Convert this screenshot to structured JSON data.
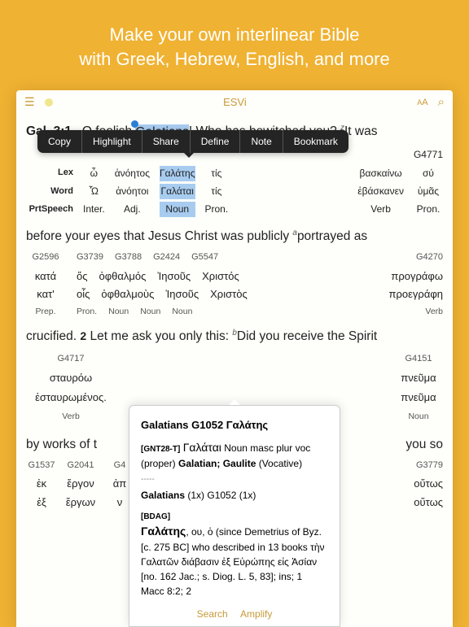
{
  "promo": {
    "line1": "Make your own interlinear Bible",
    "line2": "with Greek, Hebrew, English, and more"
  },
  "toolbar": {
    "title": "ESVi",
    "aa": "AA"
  },
  "popup": {
    "copy": "Copy",
    "highlight": "Highlight",
    "share": "Share",
    "define": "Define",
    "note": "Note",
    "bookmark": "Bookmark"
  },
  "verse1": {
    "ref": "Gal. 3:1",
    "pre": "O foolish ",
    "sel": "Galatians",
    "post1": "! Who has bewitched you? ",
    "sup_z": "z",
    "post2": "It was"
  },
  "int1": {
    "lex": "Lex",
    "word": "Word",
    "prt": "PrtSpeech",
    "s0": "",
    "s1": "",
    "s2": "",
    "s3": "",
    "s4": "",
    "s5": "",
    "s6": "G4771",
    "lx0": "ὦ",
    "lx1": "ἀνόητος",
    "lx2": "Γαλάτης",
    "lx3": "τίς",
    "lx5": "βασκαίνω",
    "lx6": "σύ",
    "wd0": "Ὦ",
    "wd1": "ἀνόητοι",
    "wd2": "Γαλάται",
    "wd3": "τίς",
    "wd5": "ἐβάσκανεν",
    "wd6": "ὑμᾶς",
    "ps0": "Inter.",
    "ps1": "Adj.",
    "ps2": "Noun",
    "ps3": "Pron.",
    "ps5": "Verb",
    "ps6": "Pron."
  },
  "verse2": {
    "text1": "before your eyes that Jesus Christ was publicly ",
    "sup_a": "a",
    "text2": "portrayed as"
  },
  "int2": {
    "s0": "G2596",
    "s1": "G3739",
    "s2": "G3788",
    "s3": "G2424",
    "s4": "G5547",
    "s5": "G4270",
    "lx0": "κατά",
    "lx1": "ὅς",
    "lx2": "ὀφθαλμός",
    "lx3": "Ἰησοῦς",
    "lx4": "Χριστός",
    "lx5": "προγράφω",
    "wd0": "κατ'",
    "wd1": "οἷς",
    "wd2": "ὀφθαλμοὺς",
    "wd3": "Ἰησοῦς",
    "wd4": "Χριστὸς",
    "wd5": "προεγράφη",
    "ps0": "Prep.",
    "ps1": "Pron.",
    "ps2": "Noun",
    "ps3": "Noun",
    "ps4": "Noun",
    "ps5": "Verb"
  },
  "verse3": {
    "text1": "crucified. ",
    "num": "2",
    "text2": " Let me ask you only this: ",
    "sup_b": "b",
    "text3": "Did you receive the Spirit"
  },
  "int3": {
    "s0": "G4717",
    "s1": "G4151",
    "lx0": "σταυρόω",
    "lx1": "πνεῦμα",
    "wd0": "ἐσταυρωμένος.",
    "wd1": "πνεῦμα",
    "ps0": "Verb",
    "ps1": "Noun"
  },
  "verse4": {
    "text1": "by works of t",
    "text2": "you so"
  },
  "int4": {
    "s0": "G1537",
    "s1": "G2041",
    "s2": "G4",
    "s7": "G3779",
    "lx0": "ἐκ",
    "lx1": "ἔργον",
    "lx2": "ἀπ",
    "lx7": "οὕτως",
    "wd0": "ἐξ",
    "wd1": "ἔργων",
    "wd2": "ν",
    "wd7": "οὕτως"
  },
  "dict": {
    "title": "Galatians  G1052  Γαλάτης",
    "tag1": "[GNT28-T]",
    "w1": "Γαλάται",
    "d1": " Noun masc plur voc (proper)  ",
    "b1": "Galatian; Gaulite",
    "d1b": " (Vocative)",
    "sep": "-----",
    "b2": "Galatians",
    "d2": " (1x)   G1052 (1x)",
    "tag2": "[BDAG]",
    "hw": "Γαλάτης",
    "gen": ", ου, ὁ ",
    "body": "(since Demetrius of Byz. [c. 275 BC] who described in 13 books τὴν Γαλατῶν διάβασιν ἐξ Εὐρώπης εἰς Ἀσίαν [no. 162 Jac.; s. Diog. L. 5, 83]; ins; 1 Macc 8:2; 2",
    "search": "Search",
    "amplify": "Amplify"
  }
}
